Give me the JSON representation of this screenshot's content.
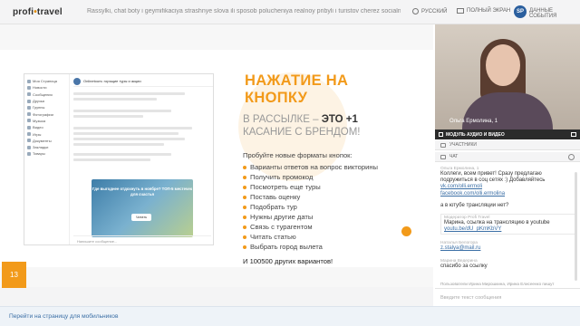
{
  "app": {
    "logo_left": "profi",
    "logo_dot": "•",
    "logo_right": "travel",
    "webinar_title": "Rassylki, chat boty i geymifikaciya strashnye slova ili sposob polucheniya realnoy pribyli i turistov cherez socialnye"
  },
  "toolbar": {
    "language": "РУССКИЙ",
    "fullscreen": "ПОЛНЫЙ ЭКРАН",
    "user_initials": "SP",
    "user_data": "ДАННЫЕ СОБЫТИЯ"
  },
  "slide": {
    "number": "13",
    "headline_1": "НАЖАТИЕ НА",
    "headline_2": "КНОПКУ",
    "sub_1a": "В РАССЫЛКЕ – ",
    "sub_1b": "ЭТО +1",
    "sub_2": "КАСАНИЕ С БРЕНДОМ!",
    "intro": "Пробуйте новые форматы кнопок:",
    "bullets": [
      "Варианты ответов на вопрос викторины",
      "Получить промокод",
      "Посмотреть еще туры",
      "Поставь оценку",
      "Подобрать тур",
      "Нужны другие даты",
      "Связь с турагентом",
      "Читать статью",
      "Выбрать город вылета"
    ],
    "more": "И 100500 других вариантов!"
  },
  "embed": {
    "side_items": [
      "Моя Страница",
      "Новости",
      "Сообщения",
      "Друзья",
      "Группы",
      "Фотографии",
      "Музыка",
      "Видео",
      "Игры",
      "Документы",
      "Закладки",
      "Товары"
    ],
    "header": "Onlinetours: горящие туры и акции",
    "button": "Читать",
    "image_text": "Где выгоднее отдохнуть в ноябре? ТОП-5 местечек для счастья",
    "input_placeholder": "Напишите сообщение..."
  },
  "video": {
    "name": "Ольга Ермолина, 1",
    "module_label": "МОДУЛЬ АУДИО И ВИДЕО"
  },
  "panel": {
    "participants": "УЧАСТНИКИ",
    "chat": "ЧАТ"
  },
  "chat": {
    "messages": [
      {
        "who": "Ольга Ермолина, 1",
        "text": "Коллеги, всем привет! Сразу предлагаю подружиться в соц сетях :) Добавляйтесь",
        "links": [
          "vk.com/olli.ermoli",
          "facebook.com/olli.ermolina"
        ]
      },
      {
        "who": "",
        "text": "а в ютубе трансляции нет?"
      },
      {
        "who": "Модератор Profi Travel",
        "text": "Марина, ссылка на трансляцию в youtube",
        "links": [
          "youtu.be/dU_pKmKbVY"
        ]
      },
      {
        "who": "Наталья Белогора",
        "text": "",
        "links": [
          "z.stalya@mail.ru"
        ]
      },
      {
        "who": "Марина Ведерина",
        "text": "спасибо за ссылку"
      }
    ],
    "notice": "Пользователи Ирина Мирошкина, Ирина Елисеенко пишут",
    "input_placeholder": "Введите текст сообщения"
  },
  "footer": {
    "mobile_link": "Перейти на страницу для мобильников"
  }
}
